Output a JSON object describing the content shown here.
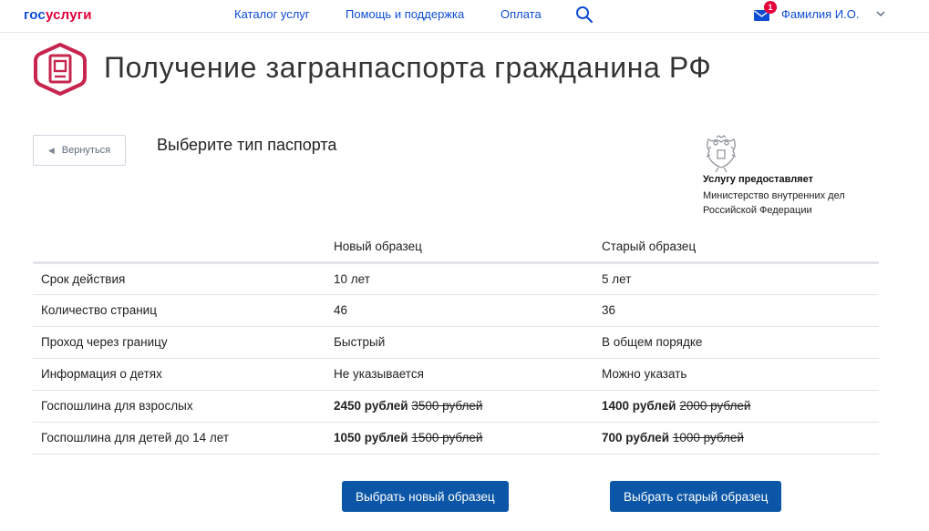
{
  "header": {
    "logo_gos": "гос",
    "logo_uslugi": "услуги",
    "nav": [
      "Каталог услуг",
      "Помощь и поддержка",
      "Оплата"
    ],
    "search_icon": "search-icon",
    "mail_icon": "mail-icon",
    "mail_badge": "1",
    "user_name": "Фамилия И.О.",
    "chevron_icon": "chevron-down-icon"
  },
  "page": {
    "title": "Получение загранпаспорта гражданина РФ",
    "service_icon": "passport-icon",
    "back_label": "Вернуться",
    "section_title": "Выберите тип паспорта"
  },
  "provider": {
    "emblem_icon": "coat-of-arms-icon",
    "label": "Услугу предоставляет",
    "name": "Министерство внутренних дел Российской Федерации"
  },
  "table": {
    "columns": [
      "",
      "Новый образец",
      "Старый образец"
    ],
    "rows": [
      {
        "label": "Срок действия",
        "new": "10 лет",
        "old": "5 лет"
      },
      {
        "label": "Количество страниц",
        "new": "46",
        "old": "36"
      },
      {
        "label": "Проход через границу",
        "new": "Быстрый",
        "old": "В общем порядке"
      },
      {
        "label": "Информация о детях",
        "new": "Не указывается",
        "old": "Можно указать"
      },
      {
        "label": "Госпошлина для взрослых",
        "new_price": "2450 рублей",
        "new_old_price": "3500 рублей",
        "old_price": "1400 рублей",
        "old_old_price": "2000 рублей"
      },
      {
        "label": "Госпошлина для детей до 14 лет",
        "new_price": "1050 рублей",
        "new_old_price": "1500 рублей",
        "old_price": "700 рублей",
        "old_old_price": "1000 рублей"
      }
    ]
  },
  "actions": {
    "select_new": "Выбрать новый образец",
    "select_old": "Выбрать старый образец"
  },
  "colors": {
    "brand_blue": "#0d4cd3",
    "brand_red": "#e4003a",
    "button_blue": "#0b56a7",
    "service_icon": "#c7254e"
  }
}
